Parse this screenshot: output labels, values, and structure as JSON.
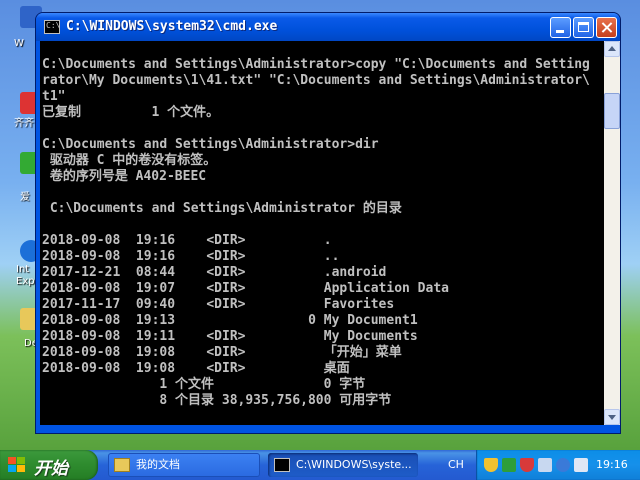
{
  "desktop": {
    "icon_labels": [
      "W",
      "齐齐",
      "爱",
      "Int",
      "Exp",
      "De"
    ]
  },
  "window": {
    "title": "C:\\WINDOWS\\system32\\cmd.exe"
  },
  "console": {
    "lines": [
      "",
      "C:\\Documents and Settings\\Administrator>copy \"C:\\Documents and Setting",
      "rator\\My Documents\\1\\41.txt\" \"C:\\Documents and Settings\\Administrator\\",
      "t1\"",
      "已复制         1 个文件。",
      "",
      "C:\\Documents and Settings\\Administrator>dir",
      " 驱动器 C 中的卷没有标签。",
      " 卷的序列号是 A402-BEEC",
      "",
      " C:\\Documents and Settings\\Administrator 的目录",
      "",
      "2018-09-08  19:16    <DIR>          .",
      "2018-09-08  19:16    <DIR>          ..",
      "2017-12-21  08:44    <DIR>          .android",
      "2018-09-08  19:07    <DIR>          Application Data",
      "2017-11-17  09:40    <DIR>          Favorites",
      "2018-09-08  19:13                 0 My Document1",
      "2018-09-08  19:11    <DIR>          My Documents",
      "2018-09-08  19:08    <DIR>          「开始」菜单",
      "2018-09-08  19:08    <DIR>          桌面",
      "               1 个文件              0 字节",
      "               8 个目录 38,935,756,800 可用字节"
    ]
  },
  "taskbar": {
    "start_label": "开始",
    "tasks": [
      {
        "label": "我的文档",
        "icon": "folder-icon"
      },
      {
        "label": "C:\\WINDOWS\\syste...",
        "icon": "cmd-icon"
      }
    ],
    "language": "CH",
    "clock": "19:16"
  },
  "colors": {
    "console_text": "#c0c0c0",
    "console_bg": "#000000",
    "titlebar": "#0054e3",
    "taskbar": "#245ad0",
    "start": "#2e8b2e"
  }
}
